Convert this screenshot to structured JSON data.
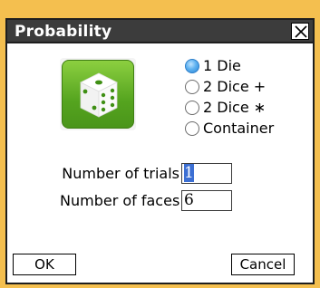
{
  "window": {
    "title": "Probability",
    "frame_color": "#f4bf4f",
    "title_bar_color": "#3c3c3c"
  },
  "icon": {
    "name": "dice-icon",
    "tile_color": "#5aa822"
  },
  "options": [
    {
      "label": "1 Die",
      "selected": true
    },
    {
      "label": "2 Dice +",
      "selected": false
    },
    {
      "label": "2 Dice ∗",
      "selected": false
    },
    {
      "label": "Container",
      "selected": false
    }
  ],
  "fields": {
    "trials": {
      "label": "Number of trials",
      "value": "1"
    },
    "faces": {
      "label": "Number of faces",
      "value": "6"
    }
  },
  "buttons": {
    "ok": "OK",
    "cancel": "Cancel"
  },
  "colors": {
    "radio_selected": "#2b86d8",
    "selection_highlight": "#3c6fd3"
  }
}
